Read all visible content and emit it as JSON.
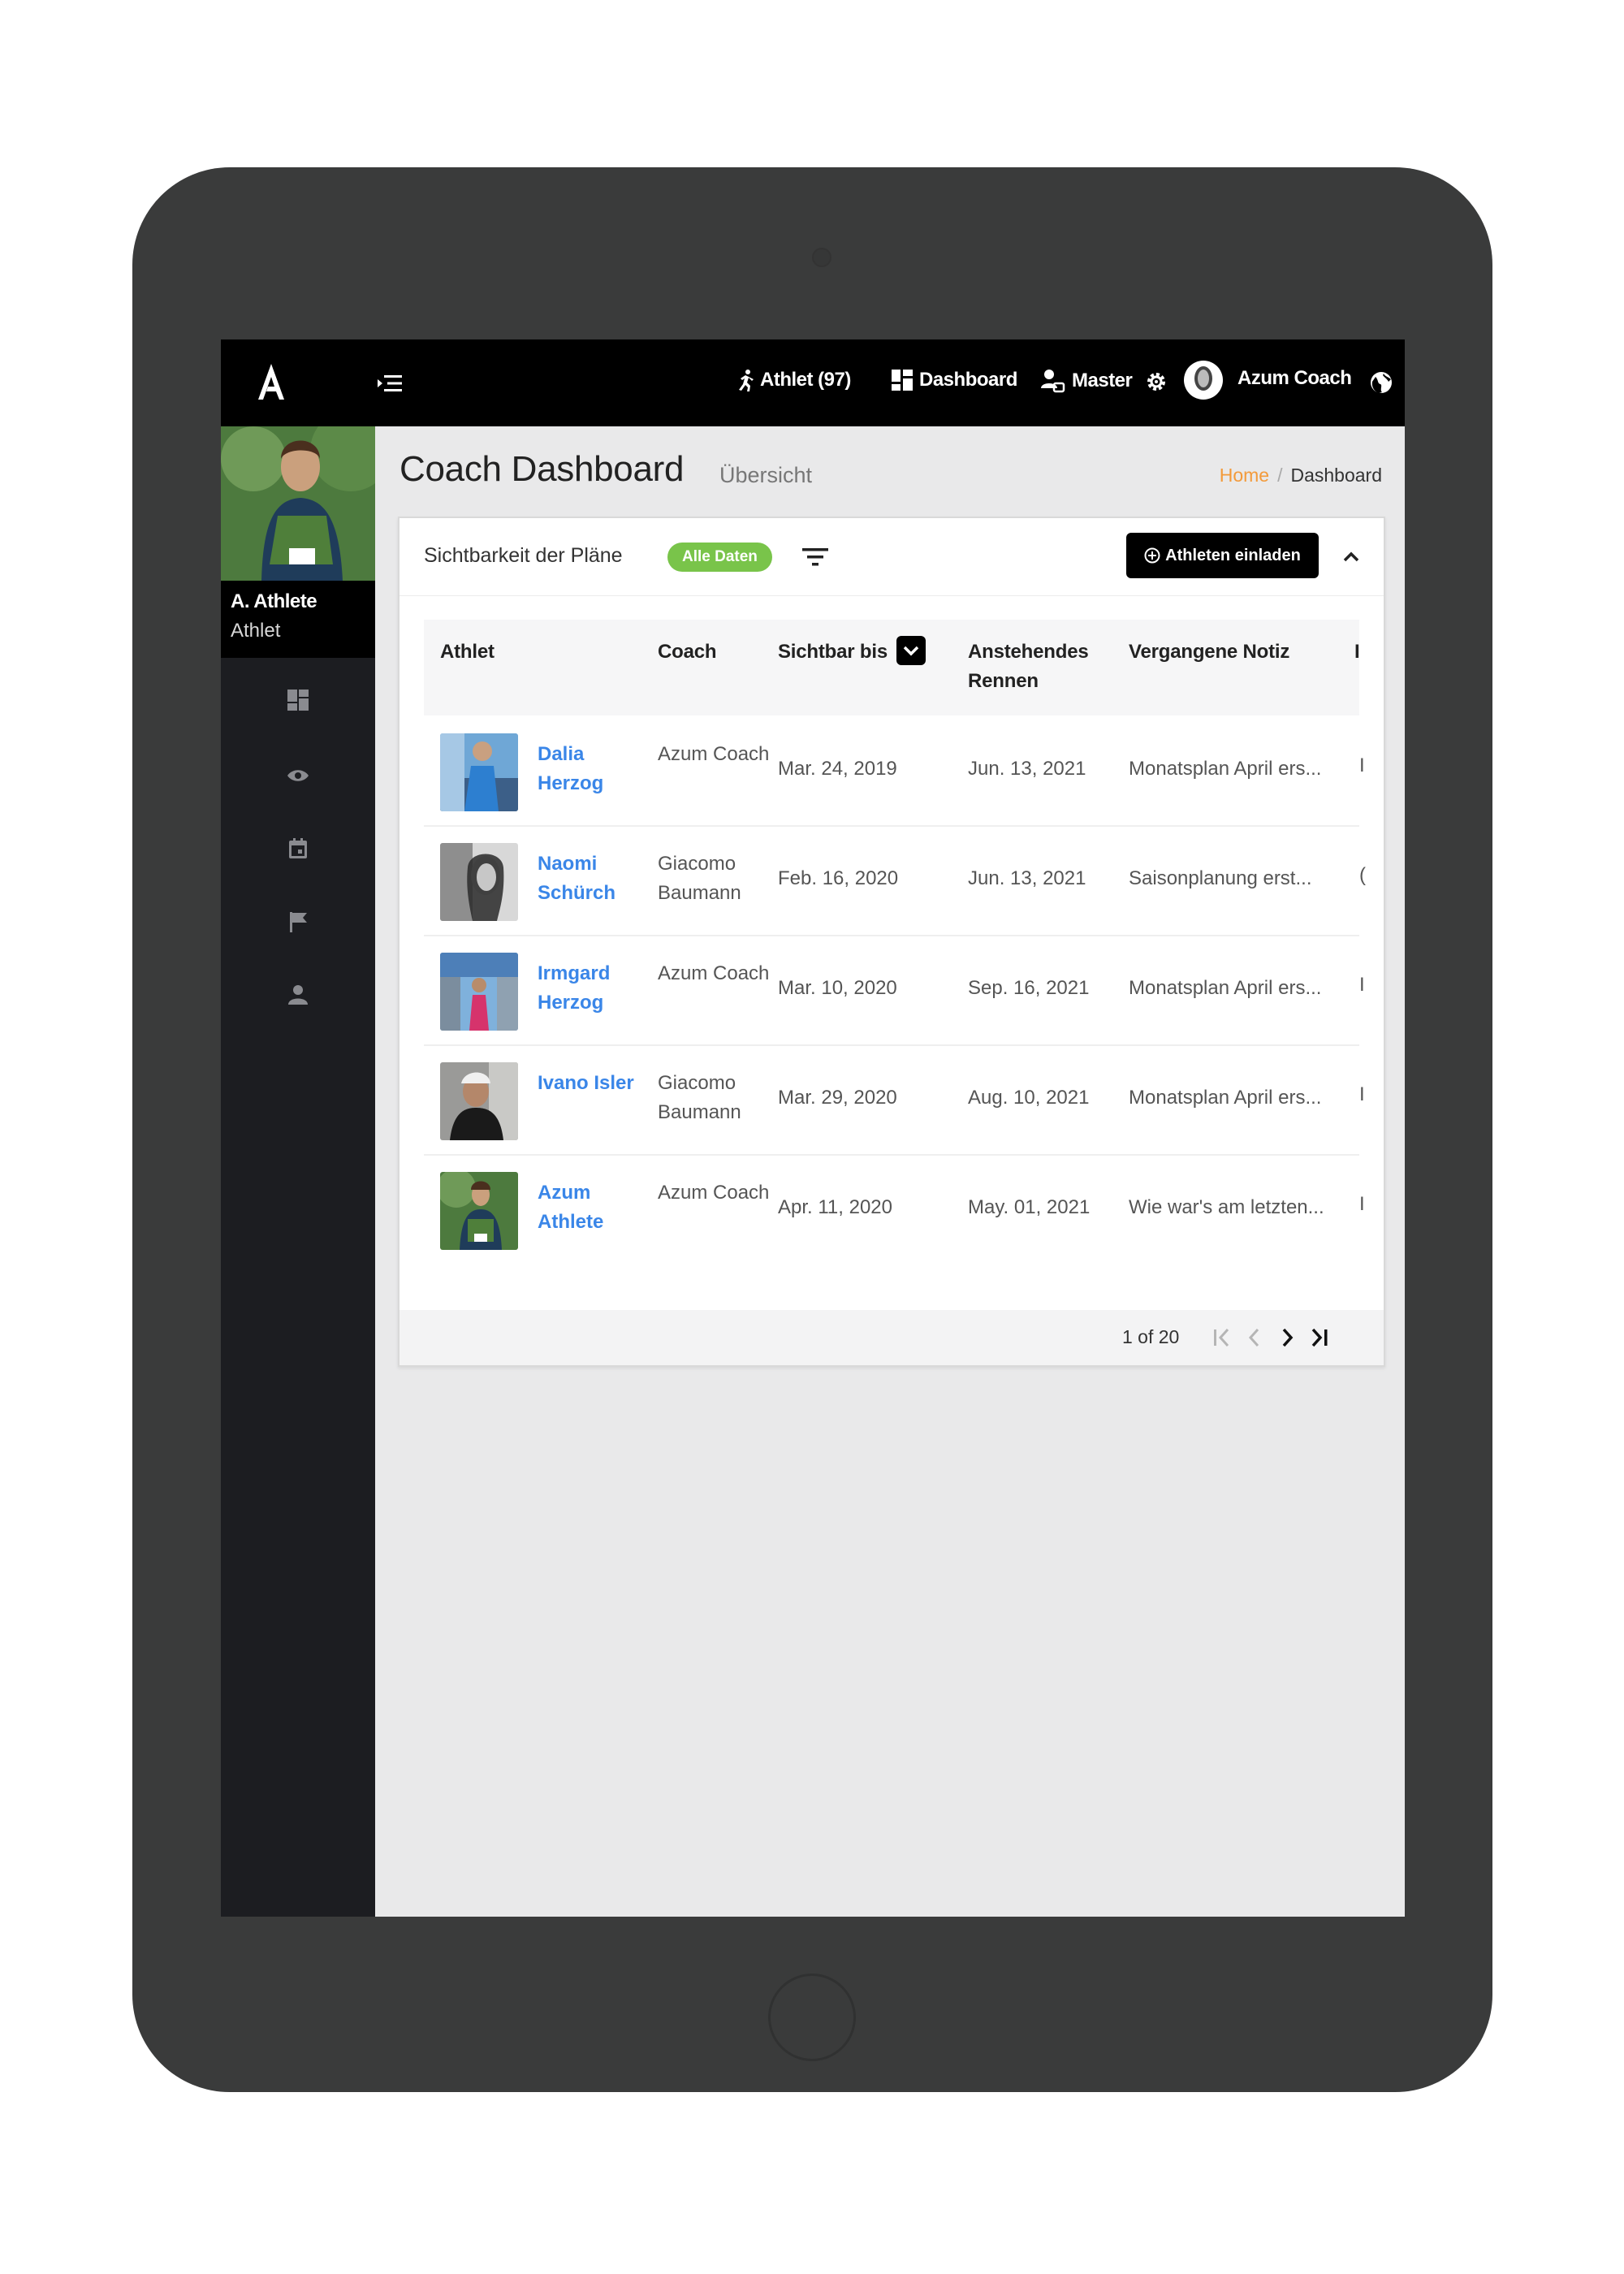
{
  "topbar": {
    "nav": [
      {
        "id": "athlet",
        "label": "Athlet (97)",
        "icon": "runner-icon"
      },
      {
        "id": "dashboard",
        "label": "Dashboard",
        "icon": "dashboard-icon"
      },
      {
        "id": "master",
        "label": "Master",
        "icon": "user-switch-icon"
      }
    ],
    "settings_icon": "gear-icon",
    "user_name": "Azum Coach",
    "language_icon": "globe-icon"
  },
  "sidebar": {
    "profile_name": "A. Athlete",
    "profile_role": "Athlet",
    "icons": [
      "dashboard-icon",
      "eye-icon",
      "calendar-icon",
      "flag-icon",
      "users-icon"
    ]
  },
  "page": {
    "title": "Coach Dashboard",
    "subtitle": "Übersicht",
    "breadcrumb_home": "Home",
    "breadcrumb_sep": "/",
    "breadcrumb_current": "Dashboard"
  },
  "card": {
    "visibility_label": "Sichtbarkeit der Pläne",
    "badge": "Alle Daten",
    "invite_button": "Athleten einladen",
    "colors": {
      "accent": "#3a86e8",
      "badge": "#79c44a",
      "breadcrumb": "#f39a3a"
    }
  },
  "table": {
    "headers": {
      "athlet": "Athlet",
      "coach": "Coach",
      "sichtbar": "Sichtbar bis",
      "rennen": "Anstehendes Rennen",
      "notiz": "Vergangene Notiz",
      "extra": "I"
    },
    "rows": [
      {
        "name": "Dalia Herzog",
        "coach": "Azum Coach",
        "sichtbar": "Mar. 24, 2019",
        "rennen": "Jun. 13, 2021",
        "notiz": "Monatsplan April ers...",
        "extra": "I"
      },
      {
        "name": "Naomi Schürch",
        "coach": "Giacomo Baumann",
        "sichtbar": "Feb. 16, 2020",
        "rennen": "Jun. 13, 2021",
        "notiz": "Saisonplanung erst...",
        "extra": "("
      },
      {
        "name": "Irmgard Herzog",
        "coach": "Azum Coach",
        "sichtbar": "Mar. 10, 2020",
        "rennen": "Sep. 16, 2021",
        "notiz": "Monatsplan April ers...",
        "extra": "I"
      },
      {
        "name": "Ivano Isler",
        "coach": "Giacomo Baumann",
        "sichtbar": "Mar. 29, 2020",
        "rennen": "Aug. 10, 2021",
        "notiz": "Monatsplan April ers...",
        "extra": "I"
      },
      {
        "name": "Azum Athlete",
        "coach": "Azum Coach",
        "sichtbar": "Apr. 11, 2020",
        "rennen": "May. 01, 2021",
        "notiz": "Wie war's am letzten...",
        "extra": "I"
      }
    ]
  },
  "pagination": {
    "info": "1 of 20"
  }
}
